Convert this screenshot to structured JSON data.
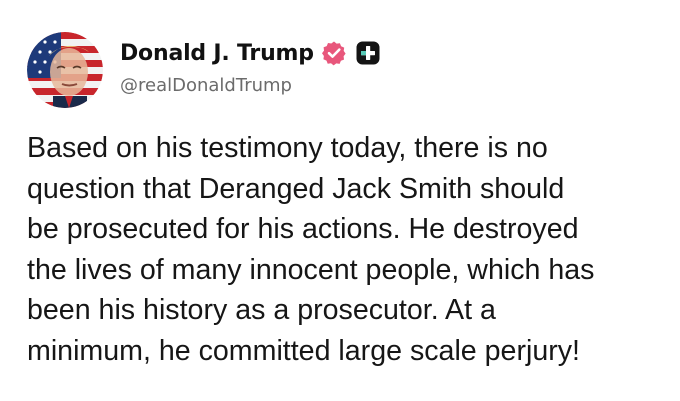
{
  "author": {
    "display_name": "Donald J. Trump",
    "handle": "@realDonaldTrump",
    "avatar_icon": "profile-avatar-flag-portrait",
    "verified_icon": "verified-badge-icon",
    "verified_color": "#e8577c",
    "plus_icon": "plus-badge-icon"
  },
  "post": {
    "text": "Based on his testimony today, there is no\nquestion that Deranged Jack Smith should\nbe prosecuted for his actions. He destroyed\nthe lives of many innocent people, which has\nbeen his history as a prosecutor. At a\nminimum, he committed large scale perjury!"
  }
}
